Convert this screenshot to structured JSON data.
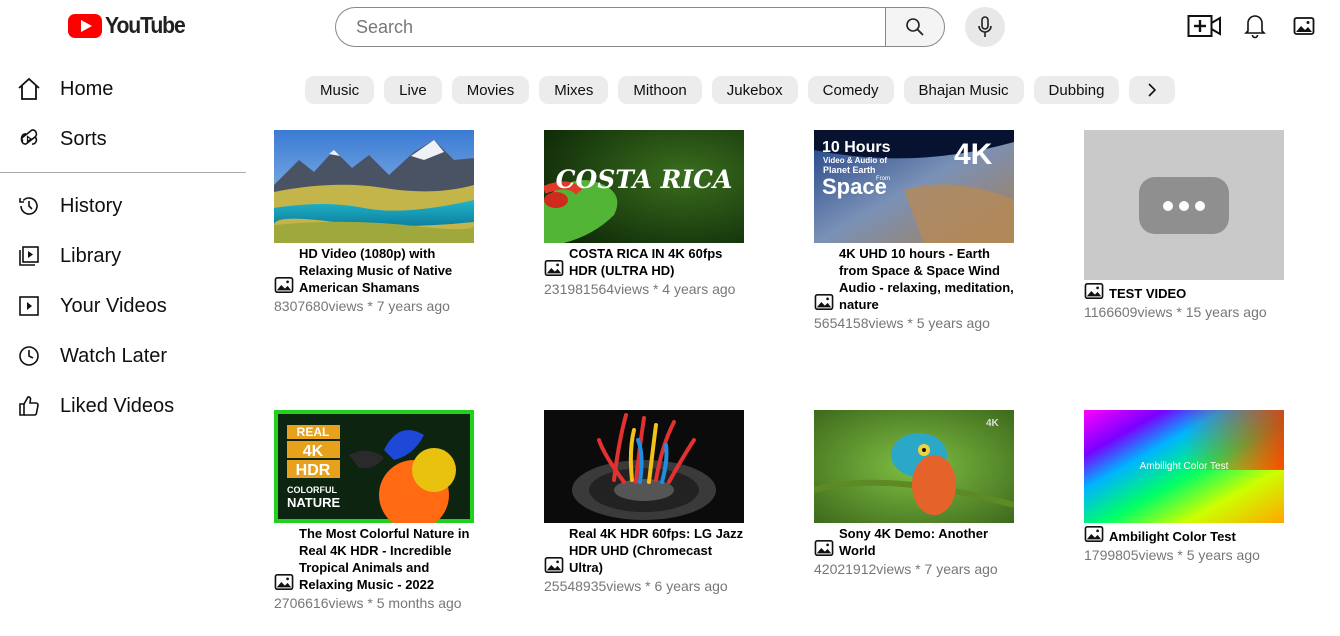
{
  "header": {
    "logo_text": "YouTube",
    "search_placeholder": "Search"
  },
  "sidebar": {
    "items": [
      {
        "label": "Home",
        "icon": "home-icon"
      },
      {
        "label": "Sorts",
        "icon": "shorts-icon"
      },
      {
        "label": "History",
        "icon": "history-icon"
      },
      {
        "label": "Library",
        "icon": "library-icon"
      },
      {
        "label": "Your Videos",
        "icon": "your-videos-icon"
      },
      {
        "label": "Watch Later",
        "icon": "watch-later-icon"
      },
      {
        "label": "Liked Videos",
        "icon": "thumbs-up-icon"
      }
    ]
  },
  "chips": [
    "Music",
    "Live",
    "Movies",
    "Mixes",
    "Mithoon",
    "Jukebox",
    "Comedy",
    "Bhajan Music",
    "Dubbing"
  ],
  "videos": [
    {
      "title": "HD Video (1080p) with Relaxing Music of Native American Shamans",
      "stats": "8307680views * 7 years ago"
    },
    {
      "title": "COSTA RICA IN 4K 60fps HDR (ULTRA HD)",
      "stats": "231981564views * 4 years ago",
      "thumb_text": "COSTA RICA"
    },
    {
      "title": "4K UHD 10 hours - Earth from Space & Space Wind Audio - relaxing, meditation, nature",
      "stats": "5654158views * 5 years ago",
      "thumb_text": {
        "a": "10 Hours",
        "b": "Video & Audio of",
        "c": "Planet Earth",
        "d": "From",
        "e": "Space",
        "f": "4K"
      }
    },
    {
      "title": "TEST VIDEO",
      "stats": "1166609views * 15 years ago"
    },
    {
      "title": "The Most Colorful Nature in Real 4K HDR - Incredible Tropical Animals and Relaxing Music - 2022",
      "stats": "2706616views * 5 months ago",
      "thumb_text": {
        "a": "REAL",
        "b": "4K",
        "c": "HDR",
        "d": "COLORFUL",
        "e": "NATURE"
      }
    },
    {
      "title": "Real 4K HDR 60fps: LG Jazz HDR UHD (Chromecast Ultra)",
      "stats": "25548935views * 6 years ago"
    },
    {
      "title": "Sony 4K Demo: Another World",
      "stats": "42021912views * 7 years ago",
      "thumb_text": "4K"
    },
    {
      "title": "Ambilight Color Test",
      "stats": "1799805views * 5 years ago",
      "thumb_text": "Ambilight Color Test"
    }
  ],
  "colors": {
    "brand_red": "#ff0000",
    "chip_bg": "#ececec",
    "stats_gray": "#777777"
  }
}
